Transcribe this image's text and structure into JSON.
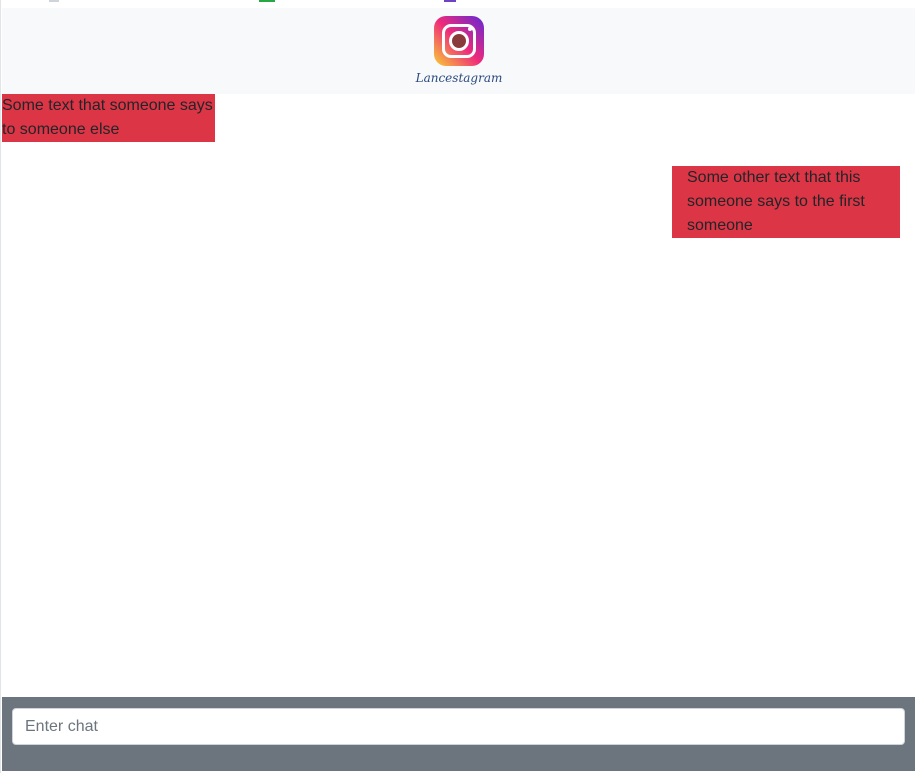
{
  "app": {
    "brand_name": "Lancestagram",
    "logo_icon": "instagram-camera-icon"
  },
  "messages": [
    {
      "text": "Some text that someone says to someone else",
      "side": "left"
    },
    {
      "text": "Some other text that this someone says to the first someone",
      "side": "right"
    }
  ],
  "chat_input": {
    "placeholder": "Enter chat",
    "value": ""
  },
  "colors": {
    "header_bg": "#f8f9fa",
    "bubble_bg": "#dc3545",
    "footer_bg": "#6c757d",
    "page_bg": "#ffffff"
  }
}
